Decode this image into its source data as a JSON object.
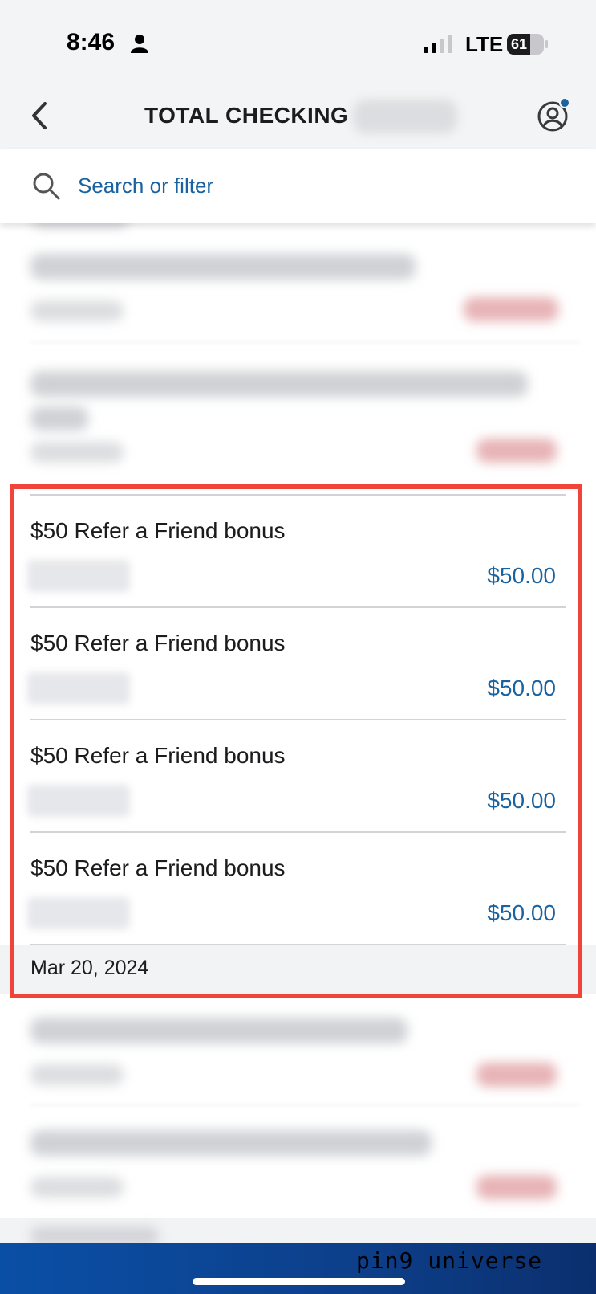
{
  "status_bar": {
    "time": "8:46",
    "network": "LTE",
    "battery": "61"
  },
  "header": {
    "title": "TOTAL CHECKING"
  },
  "search": {
    "placeholder": "Search or filter"
  },
  "transactions": [
    {
      "name": "$50 Refer a Friend bonus",
      "amount": "$50.00"
    },
    {
      "name": "$50 Refer a Friend bonus",
      "amount": "$50.00"
    },
    {
      "name": "$50 Refer a Friend bonus",
      "amount": "$50.00"
    },
    {
      "name": "$50 Refer a Friend bonus",
      "amount": "$50.00"
    }
  ],
  "date_group": "Mar 20, 2024",
  "watermark": "pin9 universe",
  "colors": {
    "accent": "#1a63a0",
    "highlight": "#f0433a",
    "brand_bar": "#0d3f8a"
  }
}
